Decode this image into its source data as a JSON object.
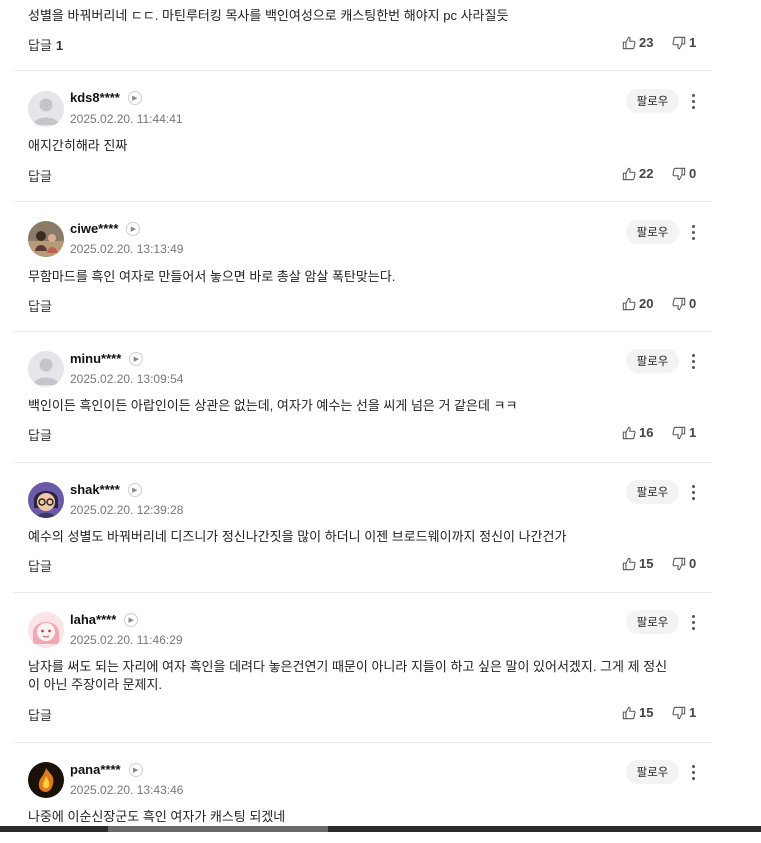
{
  "top_comment": {
    "text": "성별을 바꿔버리네 ㄷㄷ. 마틴루터킹 목사를 백인여성으로 캐스팅한번 해야지 pc 사라질듯",
    "reply_label": "답글",
    "reply_count": "1",
    "likes": "23",
    "dislikes": "1"
  },
  "follow_label": "팔로우",
  "comments": [
    {
      "author": "kds8****",
      "time": "2025.02.20. 11:44:41",
      "text": "애지간히해라 진짜",
      "reply_label": "답글",
      "likes": "22",
      "dislikes": "0",
      "avatar": "default-avatar-icon"
    },
    {
      "author": "ciwe****",
      "time": "2025.02.20. 13:13:49",
      "text": "무함마드를 흑인 여자로 만들어서 놓으면 바로 총살 암살 폭탄맞는다.",
      "reply_label": "답글",
      "likes": "20",
      "dislikes": "0",
      "avatar": "photo-avatar"
    },
    {
      "author": "minu****",
      "time": "2025.02.20. 13:09:54",
      "text": "백인이든 흑인이든 아랍인이든 상관은 없는데, 여자가 예수는 선을 씨게 넘은 거 같은데 ㅋㅋ",
      "reply_label": "답글",
      "likes": "16",
      "dislikes": "1",
      "avatar": "default-avatar-icon"
    },
    {
      "author": "shak****",
      "time": "2025.02.20. 12:39:28",
      "text": "예수의 성별도 바꿔버리네 디즈니가 정신나간짓을 많이 하더니 이젠 브로드웨이까지 정신이 나간건가",
      "reply_label": "답글",
      "likes": "15",
      "dislikes": "0",
      "avatar": "cartoon-avatar"
    },
    {
      "author": "laha****",
      "time": "2025.02.20. 11:46:29",
      "text": "남자를 써도 되는 자리에 여자 흑인을 데려다 놓은건연기 때문이 아니라 지들이 하고 싶은 말이 있어서겠지. 그게 제 정신이 아닌 주장이라 문제지.",
      "reply_label": "답글",
      "likes": "15",
      "dislikes": "1",
      "avatar": "anime-avatar"
    },
    {
      "author": "pana****",
      "time": "2025.02.20. 13:43:46",
      "text": "나중에 이순신장군도 흑인 여자가 캐스팅 되겠네",
      "avatar": "fire-avatar"
    }
  ],
  "colors": {
    "text": "#222222",
    "muted": "#777777",
    "divider": "#ececec",
    "button_bg": "#f3f3f3"
  }
}
